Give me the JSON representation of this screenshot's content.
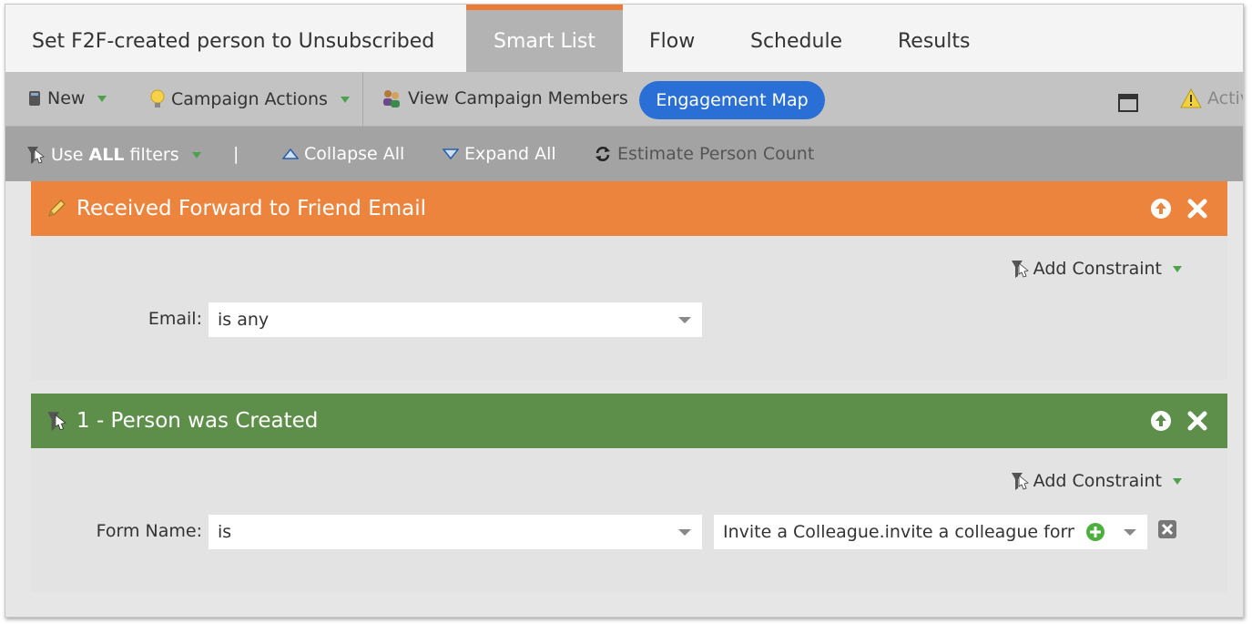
{
  "window": {
    "campaign_title": "Set F2F-created person to Unsubscribed",
    "tabs": [
      {
        "label": "Smart List",
        "active": true
      },
      {
        "label": "Flow",
        "active": false
      },
      {
        "label": "Schedule",
        "active": false
      },
      {
        "label": "Results",
        "active": false
      }
    ]
  },
  "toolbar": {
    "new_label": "New",
    "campaign_actions_label": "Campaign Actions",
    "view_members_label": "View Campaign Members",
    "engagement_map_label": "Engagement Map",
    "activate_label": "Activ"
  },
  "filterbar": {
    "use_label": "Use ",
    "use_bold": "ALL",
    "use_suffix": " filters",
    "pipe": "|",
    "collapse_label": "Collapse All",
    "expand_label": "Expand All",
    "estimate_label": "Estimate Person Count"
  },
  "filters": [
    {
      "title": "Received Forward to Friend Email",
      "header_color": "#ed843e",
      "add_constraint_label": "Add Constraint",
      "field_label": "Email:",
      "operator": "is any"
    },
    {
      "title": "1 - Person was Created",
      "header_color": "#5e8f4a",
      "add_constraint_label": "Add Constraint",
      "field_label": "Form Name:",
      "operator": "is",
      "value": "Invite a Colleague.invite a colleague form"
    }
  ],
  "colors": {
    "accent_orange": "#ec7a35",
    "engagement_blue": "#2a6fd6",
    "caret_green": "#4da34d"
  }
}
